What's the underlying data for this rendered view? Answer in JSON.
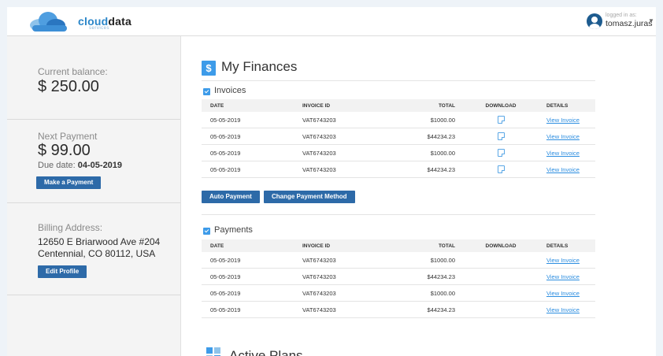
{
  "header": {
    "logo_part1": "cloud",
    "logo_part2": "data",
    "logo_sub": "services",
    "logged_in_label": "logged in as:",
    "username": "tomasz.juras"
  },
  "sidebar": {
    "balance_label": "Current balance:",
    "balance_value": "$ 250.00",
    "next_payment_label": "Next Payment",
    "next_payment_value": "$ 99.00",
    "due_prefix": "Due date:",
    "due_date": "04-05-2019",
    "make_payment_label": "Make a Payment",
    "billing_label": "Billing Address:",
    "address_line1": "12650 E Briarwood Ave #204",
    "address_line2": "Centennial, CO 80112, USA",
    "edit_profile_label": "Edit Profile"
  },
  "main": {
    "title": "My Finances",
    "icon_glyph": "$",
    "invoices": {
      "title": "Invoices",
      "headers": [
        "DATE",
        "INVOICE ID",
        "TOTAL",
        "DOWNLOAD",
        "DETAILS"
      ],
      "rows": [
        {
          "date": "05-05-2019",
          "id": "VAT6743203",
          "total": "$1000.00",
          "details": "View Invoice"
        },
        {
          "date": "05-05-2019",
          "id": "VAT6743203",
          "total": "$44234.23",
          "details": "View Invoice"
        },
        {
          "date": "05-05-2019",
          "id": "VAT6743203",
          "total": "$1000.00",
          "details": "View Invoice"
        },
        {
          "date": "05-05-2019",
          "id": "VAT6743203",
          "total": "$44234.23",
          "details": "View Invoice"
        }
      ],
      "auto_payment_label": "Auto Payment",
      "change_method_label": "Change Payment Method"
    },
    "payments": {
      "title": "Payments",
      "headers": [
        "DATE",
        "INVOICE ID",
        "TOTAL",
        "DOWNLOAD",
        "DETAILS"
      ],
      "rows": [
        {
          "date": "05-05-2019",
          "id": "VAT6743203",
          "total": "$1000.00",
          "details": "View Invoice"
        },
        {
          "date": "05-05-2019",
          "id": "VAT6743203",
          "total": "$44234.23",
          "details": "View Invoice"
        },
        {
          "date": "05-05-2019",
          "id": "VAT6743203",
          "total": "$1000.00",
          "details": "View Invoice"
        },
        {
          "date": "05-05-2019",
          "id": "VAT6743203",
          "total": "$44234.23",
          "details": "View Invoice"
        }
      ]
    },
    "plans_title": "Active Plans"
  },
  "colors": {
    "accent": "#3d9be9",
    "button": "#2d6aa8",
    "link": "#2d8ee0"
  }
}
